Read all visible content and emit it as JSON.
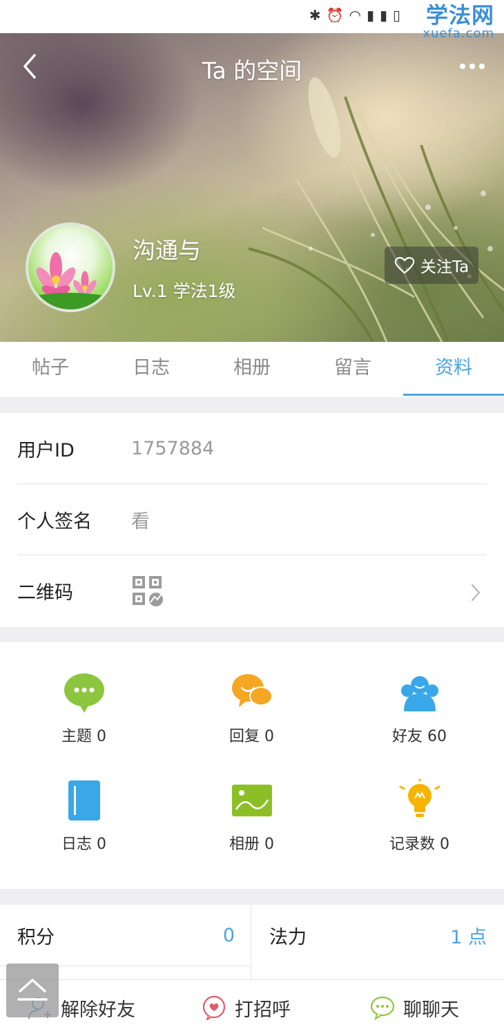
{
  "header": {
    "title": "Ta 的空间",
    "user_name": "沟通与",
    "user_level": "Lv.1 学法1级",
    "follow_label": "关注Ta"
  },
  "watermark": {
    "main": "学法网",
    "sub": "xuefa.com"
  },
  "tabs": [
    {
      "label": "帖子",
      "active": false
    },
    {
      "label": "日志",
      "active": false
    },
    {
      "label": "相册",
      "active": false
    },
    {
      "label": "留言",
      "active": false
    },
    {
      "label": "资料",
      "active": true
    }
  ],
  "info": {
    "user_id_label": "用户ID",
    "user_id_value": "1757884",
    "signature_label": "个人签名",
    "signature_value": "看",
    "qrcode_label": "二维码"
  },
  "stats": {
    "topics": "主题 0",
    "replies": "回复 0",
    "friends": "好友 60",
    "logs": "日志 0",
    "albums": "相册 0",
    "records": "记录数 0"
  },
  "score": {
    "points_label": "积分",
    "points_value": "0",
    "mana_label": "法力",
    "mana_value": "1 点"
  },
  "bottom_bar": {
    "unfriend": "解除好友",
    "greet": "打招呼",
    "chat": "聊聊天"
  },
  "colors": {
    "accent": "#4aa3e0",
    "green": "#8cc63f",
    "orange": "#f5a623",
    "blue": "#3aa7e8",
    "lime": "#8cbf26",
    "yellow": "#f6b400",
    "pink": "#e05a6e"
  }
}
